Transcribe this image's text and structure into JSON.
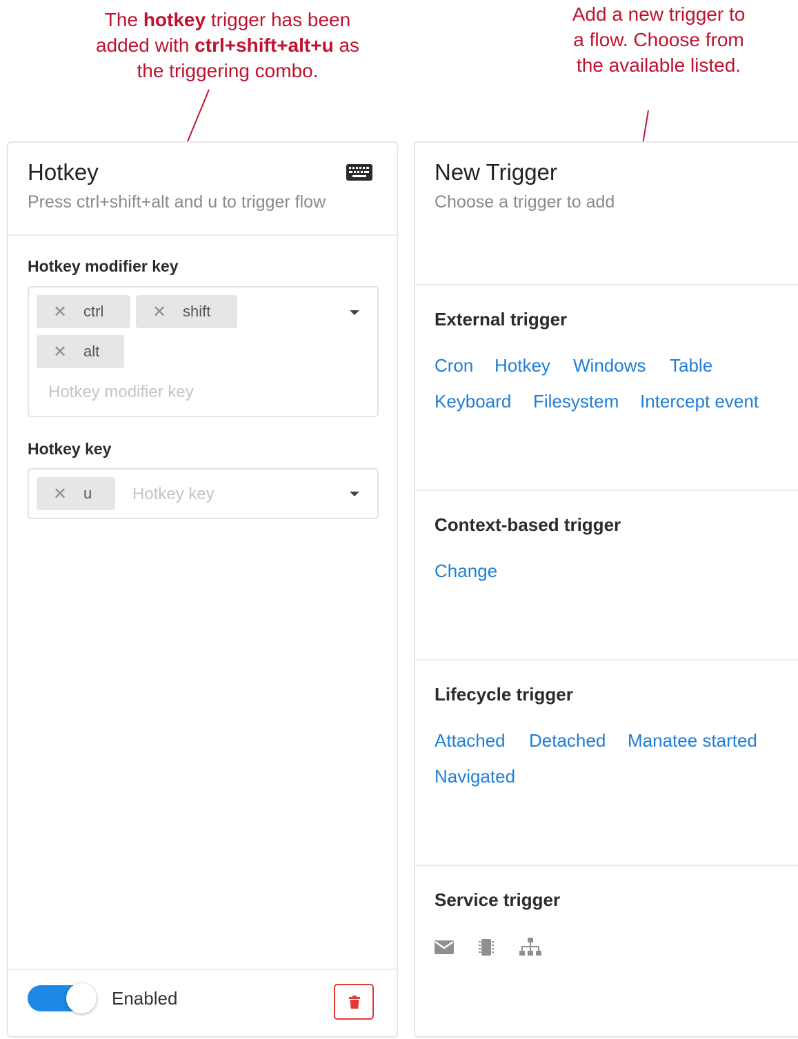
{
  "annotations": {
    "left": {
      "p1": "The ",
      "b1": "hotkey",
      "p2": " trigger has been added with ",
      "b2": "ctrl+shift+alt+u",
      "p3": " as the triggering combo."
    },
    "right": "Add a new trigger to a flow. Choose from the available listed."
  },
  "hotkey_card": {
    "title": "Hotkey",
    "subtitle": "Press ctrl+shift+alt and u to trigger flow",
    "icon": "keyboard-icon",
    "modifier_label": "Hotkey modifier key",
    "modifier_chips": [
      "ctrl",
      "shift",
      "alt"
    ],
    "modifier_placeholder": "Hotkey modifier key",
    "key_label": "Hotkey key",
    "key_chips": [
      "u"
    ],
    "key_placeholder": "Hotkey key",
    "remove_glyph": "✕",
    "enabled_label": "Enabled",
    "enabled": true
  },
  "new_trigger_card": {
    "title": "New Trigger",
    "subtitle": "Choose a trigger to add",
    "sections": [
      {
        "title": "External trigger",
        "links": [
          "Cron",
          "Hotkey",
          "Windows",
          "Table",
          "Keyboard",
          "Filesystem",
          "Intercept event"
        ]
      },
      {
        "title": "Context-based trigger",
        "links": [
          "Change"
        ]
      },
      {
        "title": "Lifecycle trigger",
        "links": [
          "Attached",
          "Detached",
          "Manatee started",
          "Navigated"
        ]
      },
      {
        "title": "Service trigger",
        "icons": [
          "envelope-icon",
          "chip-icon",
          "network-icon"
        ]
      }
    ]
  },
  "colors": {
    "annotation": "#c0122f",
    "link": "#1e7ed6",
    "toggle": "#1e88e5",
    "danger": "#e53935"
  }
}
